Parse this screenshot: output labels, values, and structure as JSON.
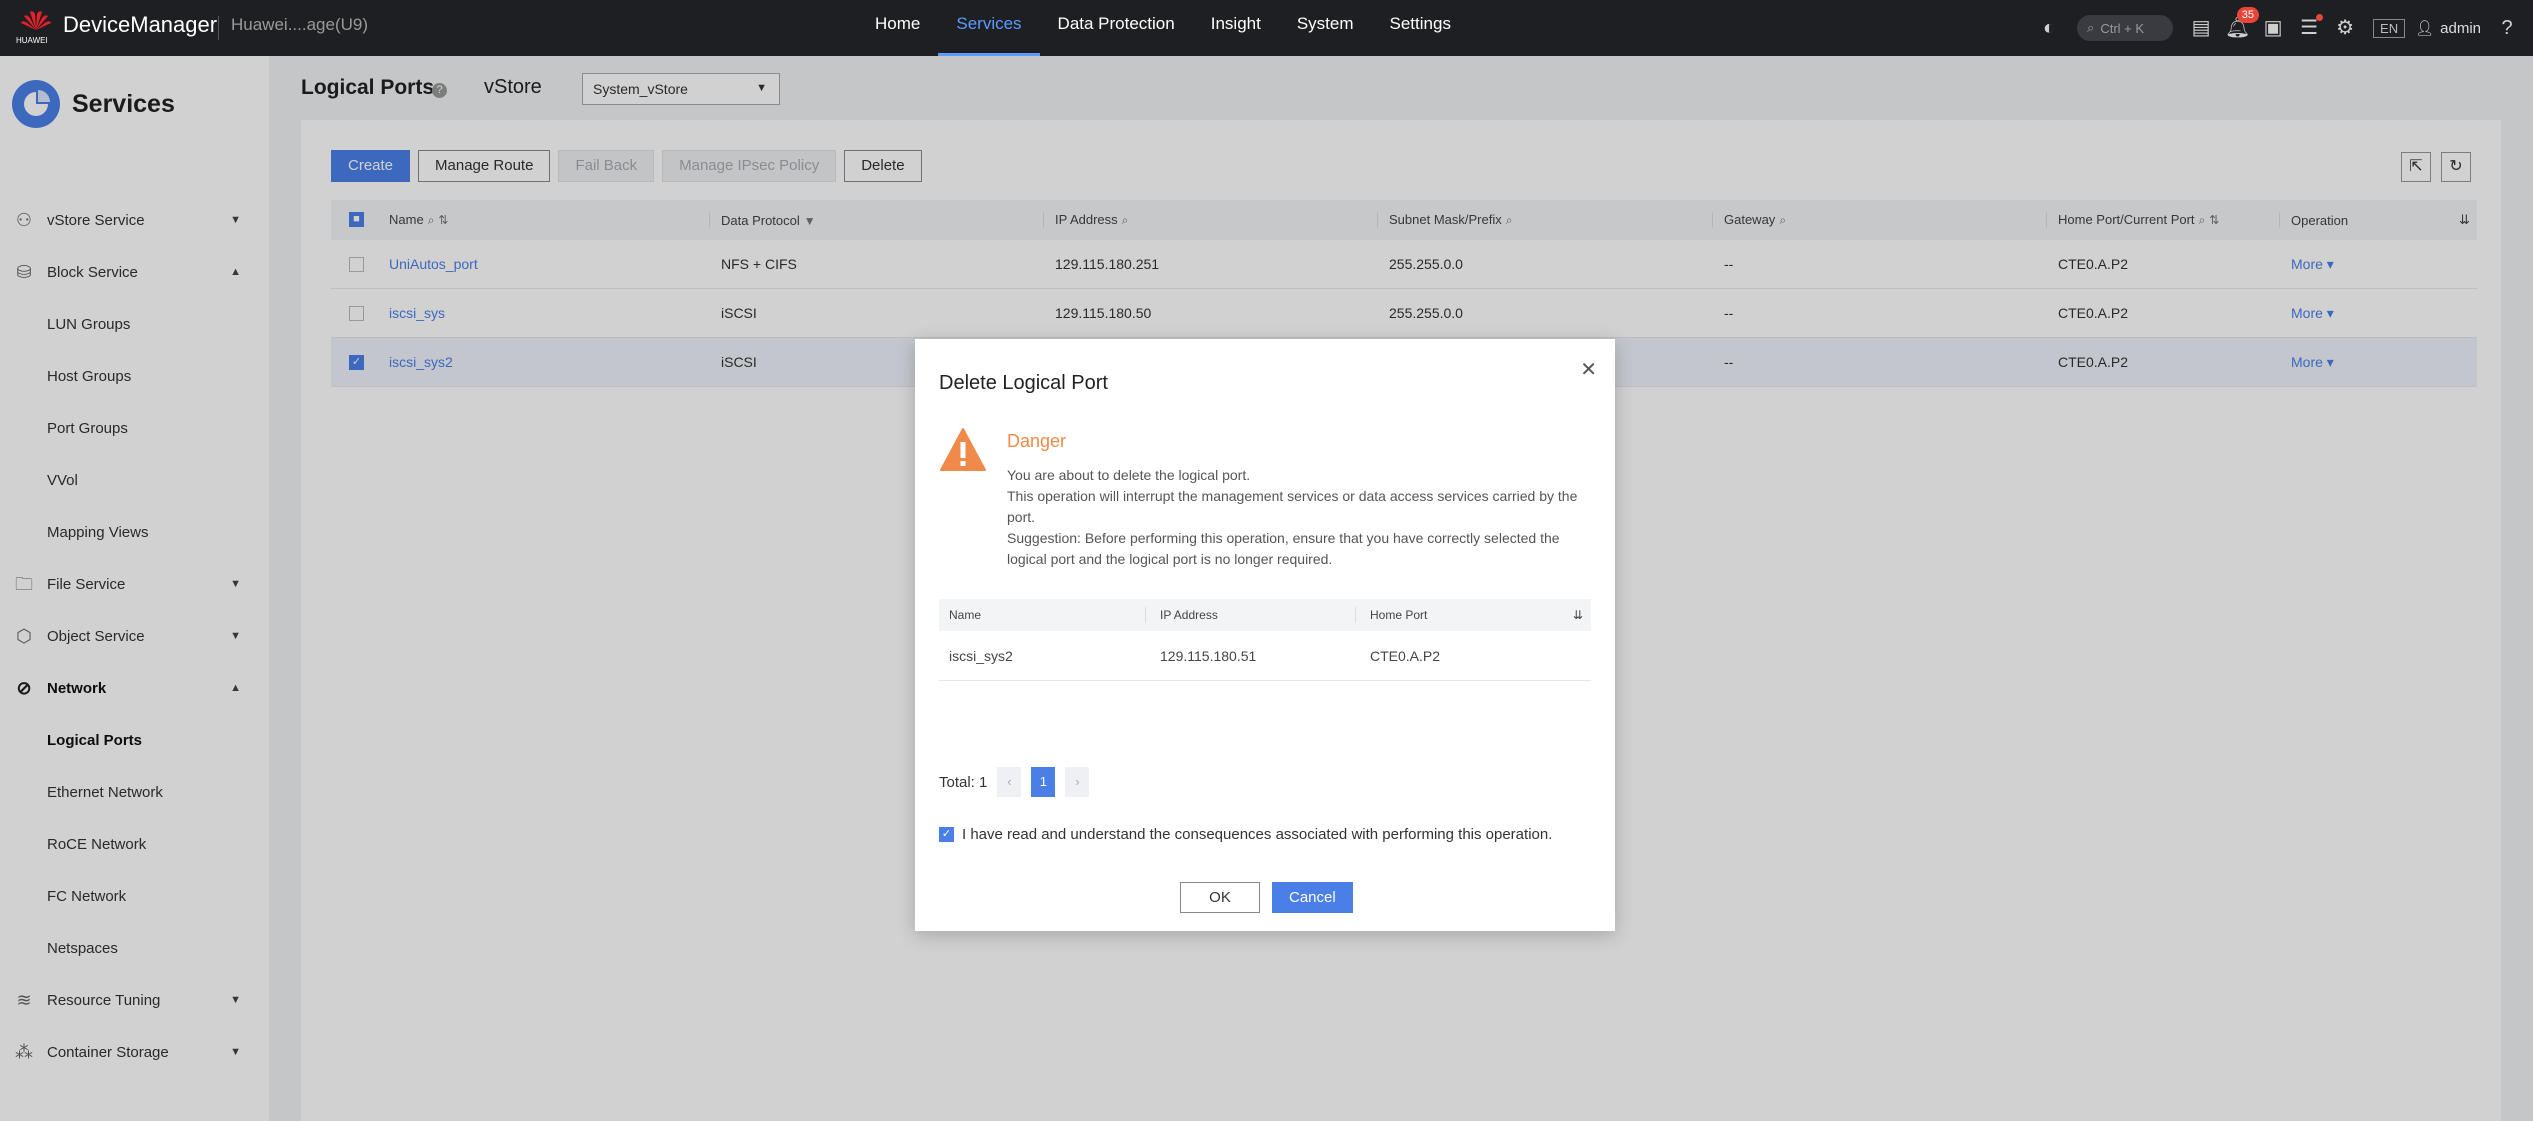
{
  "topbar": {
    "logo_text": "HUAWEI",
    "brand": "DeviceManager",
    "device": "Huawei....age(U9)",
    "nav": [
      "Home",
      "Services",
      "Data Protection",
      "Insight",
      "System",
      "Settings"
    ],
    "active_nav": "Services",
    "search_shortcut": "Ctrl + K",
    "alarm_count": "35",
    "lang": "EN",
    "user": "admin"
  },
  "sidebar": {
    "title": "Services",
    "items": [
      {
        "label": "vStore Service",
        "icon": "user-icon",
        "caret": "▼"
      },
      {
        "label": "Block Service",
        "icon": "database-icon",
        "caret": "▲"
      },
      {
        "label": "LUN Groups"
      },
      {
        "label": "Host Groups"
      },
      {
        "label": "Port Groups"
      },
      {
        "label": "VVol"
      },
      {
        "label": "Mapping Views"
      },
      {
        "label": "File Service",
        "icon": "folder-icon",
        "caret": "▼"
      },
      {
        "label": "Object Service",
        "icon": "object-icon",
        "caret": "▼"
      },
      {
        "label": "Network",
        "icon": "network-icon",
        "caret": "▲"
      },
      {
        "label": "Logical Ports"
      },
      {
        "label": "Ethernet Network"
      },
      {
        "label": "RoCE Network"
      },
      {
        "label": "FC Network"
      },
      {
        "label": "Netspaces"
      },
      {
        "label": "Resource Tuning",
        "icon": "layers-icon",
        "caret": "▼"
      },
      {
        "label": "Container Storage",
        "icon": "container-icon",
        "caret": "▼"
      }
    ]
  },
  "header": {
    "title": "Logical Ports",
    "vstore_label": "vStore",
    "vstore_value": "System_vStore"
  },
  "toolbar": {
    "create": "Create",
    "manage_route": "Manage Route",
    "fail_back": "Fail Back",
    "manage_ipsec": "Manage IPsec Policy",
    "delete": "Delete"
  },
  "table": {
    "columns": [
      "Name",
      "Data Protocol",
      "IP Address",
      "Subnet Mask/Prefix",
      "Gateway",
      "Home Port/Current Port",
      "Operation"
    ],
    "rows": [
      {
        "name": "UniAutos_port",
        "protocol": "NFS + CIFS",
        "ip": "129.115.180.251",
        "mask": "255.255.0.0",
        "gateway": "--",
        "port": "CTE0.A.P2",
        "op": "More"
      },
      {
        "name": "iscsi_sys",
        "protocol": "iSCSI",
        "ip": "129.115.180.50",
        "mask": "255.255.0.0",
        "gateway": "--",
        "port": "CTE0.A.P2",
        "op": "More"
      },
      {
        "name": "iscsi_sys2",
        "protocol": "iSCSI",
        "ip": "",
        "mask": "",
        "gateway": "--",
        "port": "CTE0.A.P2",
        "op": "More"
      }
    ]
  },
  "dialog": {
    "title": "Delete Logical Port",
    "danger_title": "Danger",
    "line1": "You are about to delete the logical port.",
    "line2": "This operation will interrupt the management services or data access services carried by the port.",
    "line3": "Suggestion: Before performing this operation, ensure that you have correctly selected the logical port and the logical port is no longer required.",
    "columns": [
      "Name",
      "IP Address",
      "Home Port"
    ],
    "row": {
      "name": "iscsi_sys2",
      "ip": "129.115.180.51",
      "port": "CTE0.A.P2"
    },
    "total": "Total: 1",
    "page": "1",
    "confirm_text": "I have read and understand the consequences associated with performing this operation.",
    "ok": "OK",
    "cancel": "Cancel"
  }
}
